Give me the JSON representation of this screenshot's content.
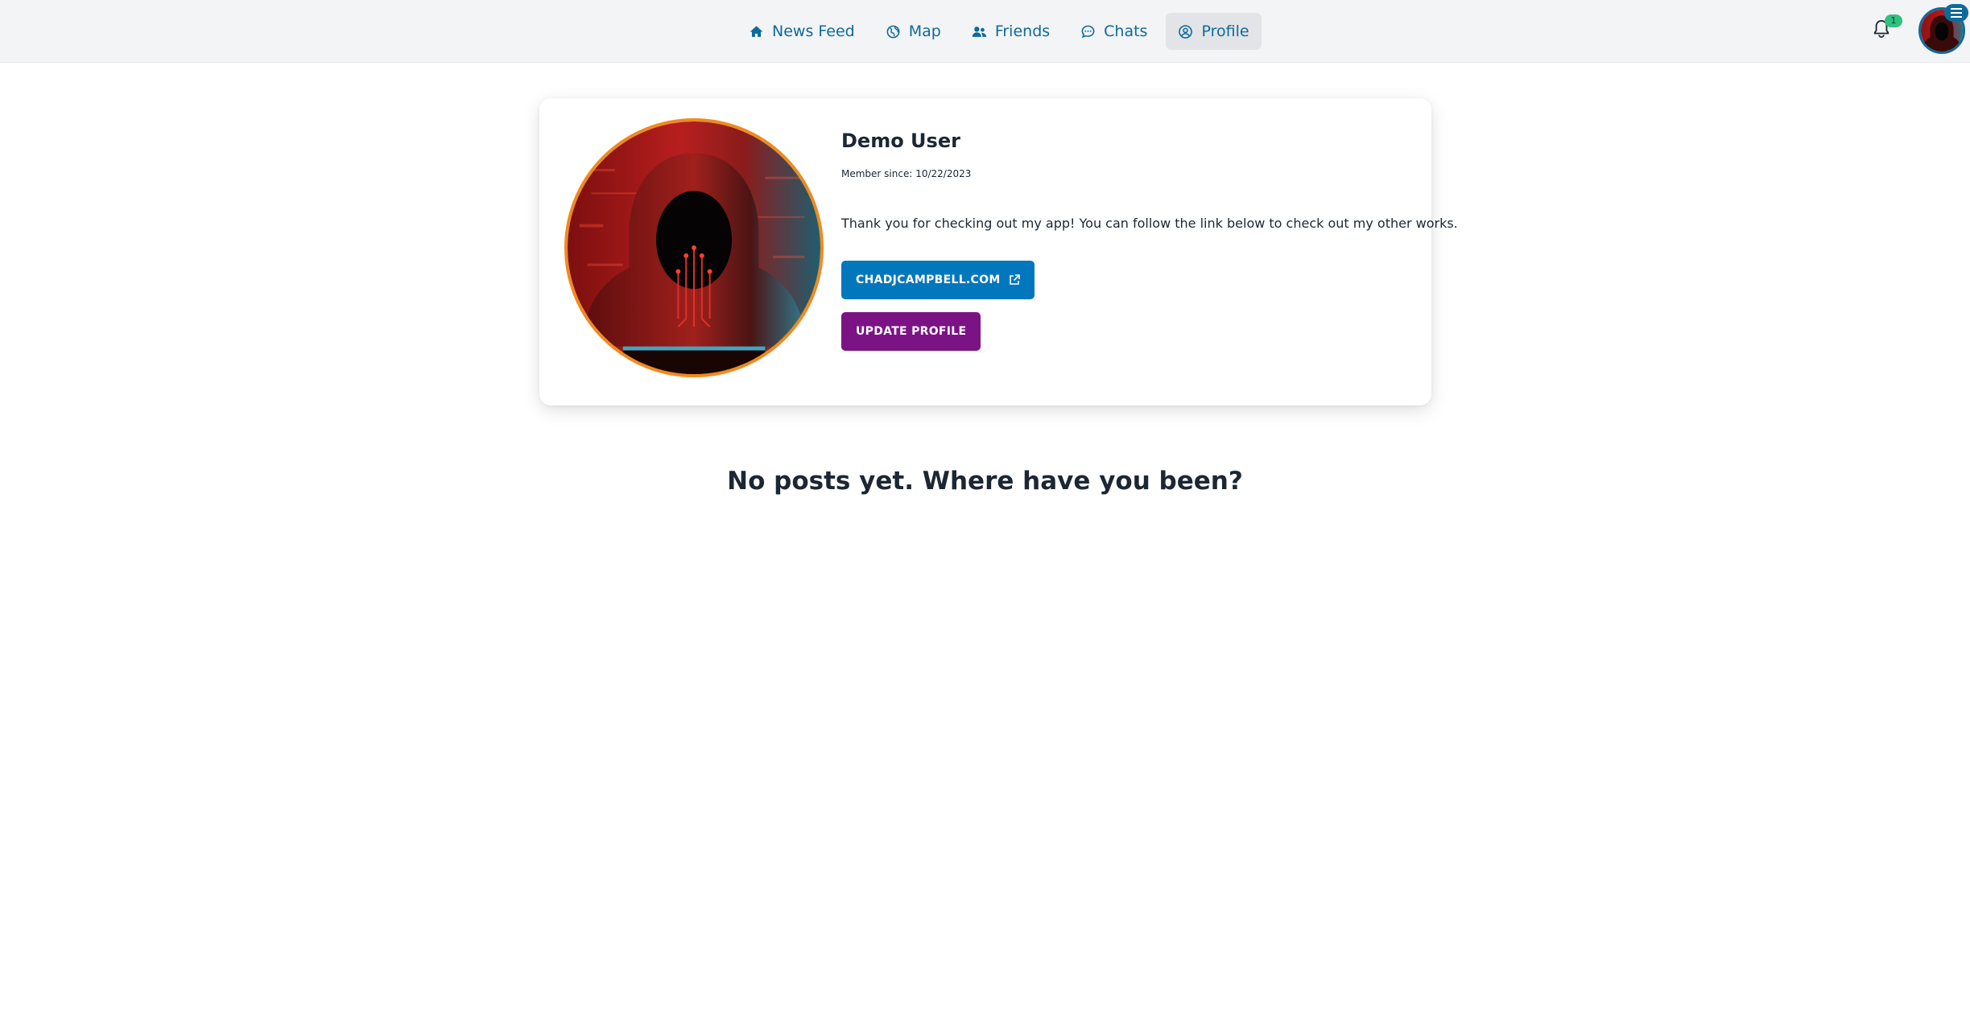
{
  "nav": {
    "items": [
      {
        "label": "News Feed",
        "icon": "home-icon",
        "active": false
      },
      {
        "label": "Map",
        "icon": "globe-icon",
        "active": false
      },
      {
        "label": "Friends",
        "icon": "users-icon",
        "active": false
      },
      {
        "label": "Chats",
        "icon": "chat-bubble-icon",
        "active": false
      },
      {
        "label": "Profile",
        "icon": "user-circle-icon",
        "active": true
      }
    ]
  },
  "notifications": {
    "icon": "bell-icon",
    "count": "1"
  },
  "account_menu": {
    "icon": "hamburger-menu-icon"
  },
  "profile": {
    "name": "Demo User",
    "member_since": "Member since: 10/22/2023",
    "bio": "Thank you for checking out my app! You can follow the link below to check out my other works.",
    "website_button": "CHADJCAMPBELL.COM",
    "website_icon": "external-link-icon",
    "update_button": "UPDATE PROFILE"
  },
  "posts": {
    "empty_message": "No posts yet. Where have you been?"
  },
  "colors": {
    "nav_text": "#0c6a9c",
    "link_button": "#0277bd",
    "update_button": "#7b1385",
    "avatar_border": "#f08a1e",
    "badge": "#2ec27e"
  }
}
